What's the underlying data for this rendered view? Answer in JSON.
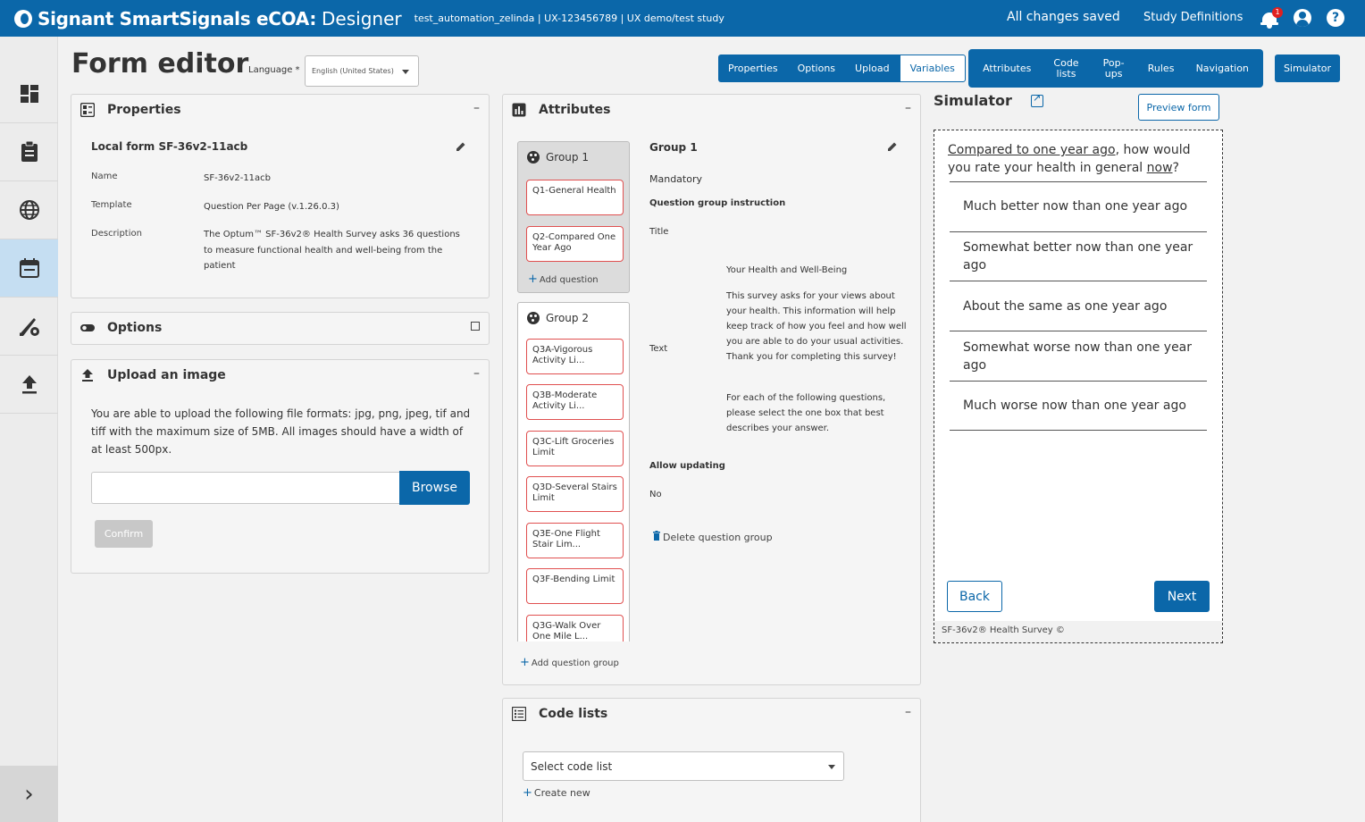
{
  "header": {
    "app_title": "Signant SmartSignals eCOA:",
    "app_subtitle": "Designer",
    "study": "test_automation_zelinda | UX-123456789 | UX demo/test study",
    "save_status": "All changes saved",
    "study_definitions": "Study Definitions",
    "notification_count": "1",
    "help_label": "?"
  },
  "sidebar": {
    "items": [
      {
        "icon": "dashboard-icon"
      },
      {
        "icon": "clipboard-icon"
      },
      {
        "icon": "globe-icon"
      },
      {
        "icon": "calendar-icon",
        "active": true
      },
      {
        "icon": "design-settings-icon"
      },
      {
        "icon": "upload-icon"
      }
    ],
    "expand_label": "›"
  },
  "page": {
    "title": "Form editor",
    "language_label": "Language *",
    "language_value": "English (United States)"
  },
  "tabs_left": [
    {
      "label": "Properties"
    },
    {
      "label": "Options"
    },
    {
      "label": "Upload"
    },
    {
      "label": "Variables",
      "selected": true
    }
  ],
  "tabs_right": [
    {
      "label": "Attributes"
    },
    {
      "label": "Code lists"
    },
    {
      "label": "Pop-ups"
    },
    {
      "label": "Rules"
    },
    {
      "label": "Navigation"
    }
  ],
  "simulator_tab": "Simulator",
  "properties": {
    "heading": "Properties",
    "form_title": "Local form SF-36v2-11acb",
    "name_label": "Name",
    "name_value": "SF-36v2-11acb",
    "template_label": "Template",
    "template_value": "Question Per Page (v.1.26.0.3)",
    "description_label": "Description",
    "description_value": "The Optum™ SF-36v2® Health Survey asks 36 questions to measure functional health and well-being from the patient"
  },
  "options": {
    "heading": "Options"
  },
  "upload": {
    "heading": "Upload an image",
    "description": "You are able to upload the following file formats: jpg, png, jpeg, tif and tiff with the maximum size of 5MB. All images should have a width of at least 500px.",
    "browse": "Browse",
    "confirm": "Confirm"
  },
  "attributes": {
    "heading": "Attributes",
    "group1": {
      "title": "Group 1",
      "questions": [
        "Q1-General Health",
        "Q2-Compared One Year Ago"
      ],
      "add_question": "Add question"
    },
    "group2": {
      "title": "Group 2",
      "questions": [
        "Q3A-Vigorous Activity Li...",
        "Q3B-Moderate Activity Li...",
        "Q3C-Lift Groceries Limit",
        "Q3D-Several Stairs Limit",
        "Q3E-One Flight Stair Lim...",
        "Q3F-Bending Limit",
        "Q3G-Walk Over One Mile L..."
      ]
    },
    "add_group": "Add question group",
    "detail": {
      "title": "Group 1",
      "mandatory": "Mandatory",
      "instruction_label": "Question group instruction",
      "title_label": "Title",
      "text_label": "Text",
      "title_value": "Your Health and Well-Being",
      "text_p1": "This survey asks for your views about your health. This information will help keep track of how you feel and how well you are able to do your usual activities. Thank you for completing this survey!",
      "text_p2": "For each of the following questions, please select the one box that best describes your answer.",
      "allow_updating_label": "Allow updating",
      "allow_updating_value": "No",
      "delete_group": "Delete question group"
    }
  },
  "code_lists": {
    "heading": "Code lists",
    "select_placeholder": "Select code list",
    "create_new": "Create new"
  },
  "simulator": {
    "title": "Simulator",
    "preview_button": "Preview form",
    "question_part1": "Compared to one year ago",
    "question_part2": ", how would you rate your health in general ",
    "question_part3": "now",
    "question_part4": "?",
    "options": [
      "Much better now than one year ago",
      "Somewhat better now than one year ago",
      "About the same as one year ago",
      "Somewhat worse now than one year ago",
      "Much worse now than one year ago"
    ],
    "back": "Back",
    "next": "Next",
    "footer": "SF-36v2® Health Survey ©"
  }
}
